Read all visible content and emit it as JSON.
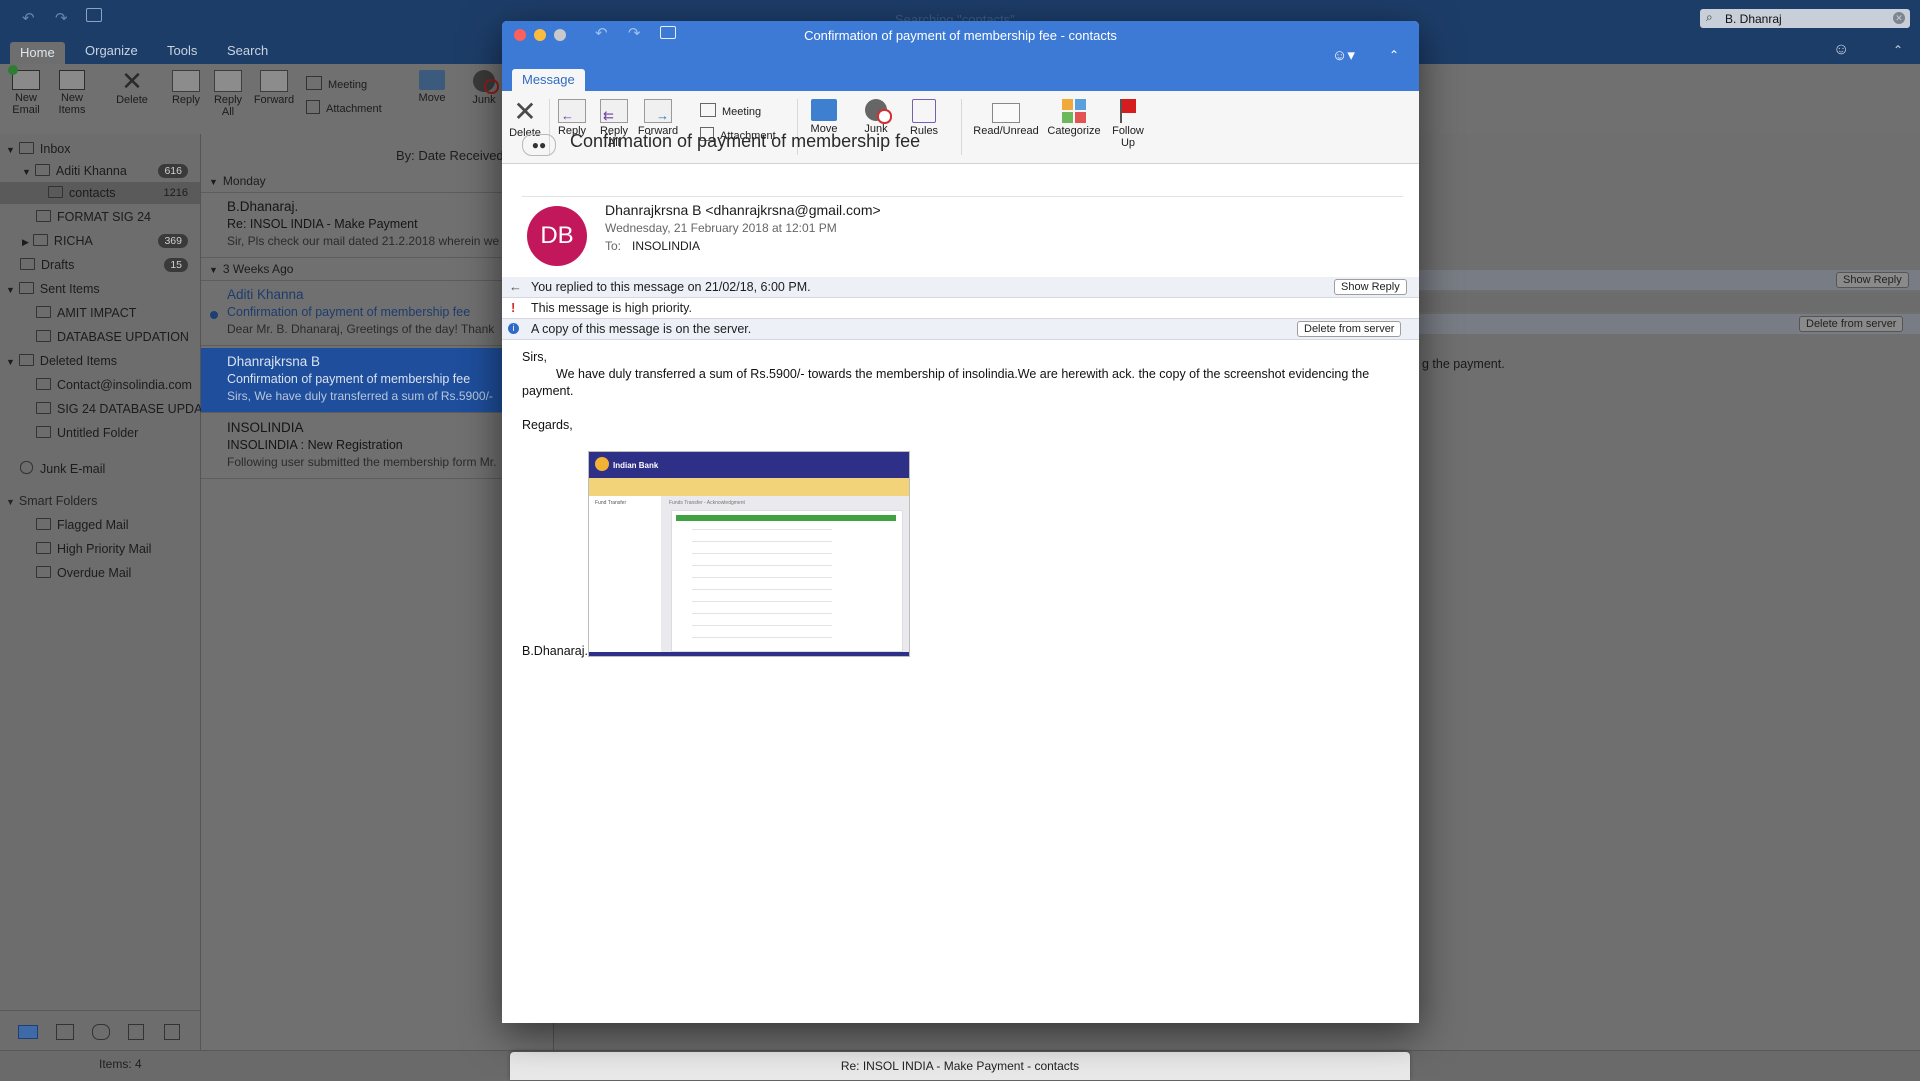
{
  "main": {
    "search_title": "Searching \"contacts\"",
    "search_value": "B. Dhanraj",
    "tabs": [
      "Home",
      "Organize",
      "Tools",
      "Search"
    ],
    "ribbon": {
      "new_email": "New\nEmail",
      "new_items": "New\nItems",
      "delete": "Delete",
      "reply": "Reply",
      "reply_all": "Reply\nAll",
      "forward": "Forward",
      "meeting": "Meeting",
      "attachment": "Attachment",
      "move": "Move",
      "junk": "Junk"
    },
    "sidebar": {
      "inbox": "Inbox",
      "aditi": {
        "label": "Aditi Khanna",
        "count": "616"
      },
      "contacts": {
        "label": "contacts",
        "count": "1216"
      },
      "format": "FORMAT SIG 24",
      "richa": {
        "label": "RICHA",
        "count": "369"
      },
      "drafts": {
        "label": "Drafts",
        "count": "15"
      },
      "sent": "Sent Items",
      "amit": "AMIT IMPACT",
      "database": "DATABASE UPDATION",
      "deleted": "Deleted Items",
      "contact_insol": "Contact@insolindia.com",
      "sig24": "SIG 24 DATABASE UPDA...",
      "untitled": "Untitled Folder",
      "junk": "Junk E-mail",
      "smart": "Smart Folders",
      "flagged": "Flagged Mail",
      "highpri": "High Priority Mail",
      "overdue": "Overdue Mail"
    },
    "list": {
      "sort": "By: Date Received",
      "group_monday": "Monday",
      "group_3weeks": "3 Weeks Ago",
      "messages": [
        {
          "sender": "B.Dhanaraj.",
          "subject": "Re: INSOL INDIA - Make Payment",
          "preview": "Sir, Pls check our mail dated 21.2.2018 wherein we"
        },
        {
          "sender": "Aditi Khanna",
          "subject": "Confirmation of payment of membership fee",
          "preview": "Dear Mr. B. Dhanaraj, Greetings of the day! Thank"
        },
        {
          "sender": "Dhanrajkrsna B",
          "subject": "Confirmation of payment of membership fee",
          "preview": "Sirs, We have duly transferred a sum of Rs.5900/-"
        },
        {
          "sender": "INSOLINDIA",
          "subject": "INSOLINDIA : New Registration",
          "preview": "Following user submitted the membership form Mr."
        }
      ]
    },
    "readpane": {
      "show_reply": "Show Reply",
      "delete_server": "Delete from server",
      "body_fragment": "g the payment."
    },
    "status_items": "Items: 4",
    "taskbar_title": "Re: INSOL INDIA - Make Payment - contacts"
  },
  "window": {
    "title": "Confirmation of payment of membership fee - contacts",
    "tab": "Message",
    "ribbon": {
      "delete": "Delete",
      "reply": "Reply",
      "reply_all": "Reply\nAll",
      "forward": "Forward",
      "meeting": "Meeting",
      "attachment": "Attachment",
      "move": "Move",
      "junk": "Junk",
      "rules": "Rules",
      "read_unread": "Read/Unread",
      "categorize": "Categorize",
      "follow_up": "Follow\nUp"
    },
    "subject": "Confirmation of payment of membership fee",
    "avatar": "DB",
    "from": "Dhanrajkrsna B <dhanrajkrsna@gmail.com>",
    "date": "Wednesday, 21 February 2018 at 12:01 PM",
    "to_label": "To:",
    "to": "INSOLINDIA",
    "info_replied": "You replied to this message on 21/02/18, 6:00 PM.",
    "show_reply": "Show Reply",
    "info_priority": "This message is high priority.",
    "info_server": "A copy of this message is on the server.",
    "delete_server": "Delete from server",
    "body": {
      "greeting": "Sirs,",
      "para": "We have duly transferred a sum of Rs.5900/- towards the membership of insolindia.We are herewith ack. the copy of the screenshot evidencing the payment.",
      "regards": "Regards,",
      "signature": "B.Dhanaraj."
    },
    "screenshot": {
      "bank": "Indian Bank",
      "section": "Fund Transfer",
      "heading": "Funds Transfer - Acknowledgment"
    }
  },
  "colors": {
    "titlebar": "#1d3d69",
    "win_title": "#3d7ad6",
    "avatar": "#c2185b",
    "selected": "#1e4e9c"
  }
}
